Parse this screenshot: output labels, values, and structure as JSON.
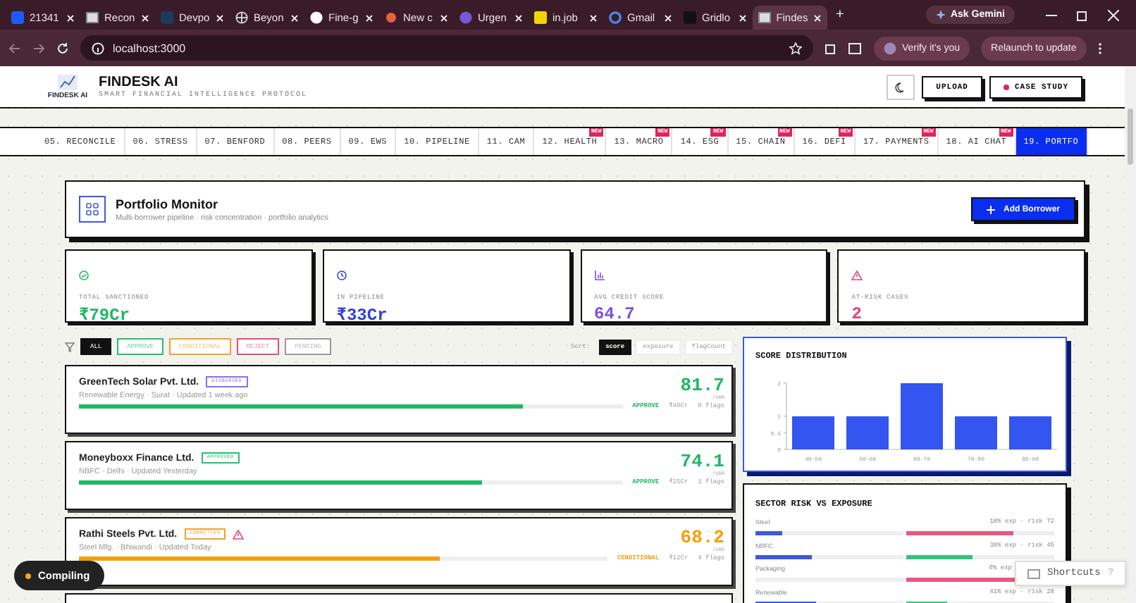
{
  "browser": {
    "tabs": [
      {
        "label": "21341",
        "selected": false
      },
      {
        "label": "Recon",
        "selected": false
      },
      {
        "label": "Devpo",
        "selected": false
      },
      {
        "label": "Beyon",
        "selected": false
      },
      {
        "label": "Fine-g",
        "selected": false
      },
      {
        "label": "New c",
        "selected": false
      },
      {
        "label": "Urgen",
        "selected": false
      },
      {
        "label": "in.job",
        "selected": false
      },
      {
        "label": "Gmail",
        "selected": false
      },
      {
        "label": "Gridlo",
        "selected": false
      },
      {
        "label": "Findes",
        "selected": true
      }
    ],
    "new_tab": "+",
    "ask": "Ask Gemini",
    "url": "localhost:3000",
    "verify": "Verify it's you",
    "relaunch": "Relaunch to update"
  },
  "header": {
    "logo_caption": "FINDESK AI",
    "title": "FINDESK AI",
    "subtitle": "SMART FINANCIAL INTELLIGENCE PROTOCOL",
    "buttons": [
      {
        "label": "UPLOAD",
        "kind": "plain"
      },
      {
        "label": "CASE STUDY",
        "kind": "dot"
      }
    ]
  },
  "nav": [
    {
      "label": "05. RECONCILE",
      "selected": false
    },
    {
      "label": "06. STRESS",
      "selected": false
    },
    {
      "label": "07. BENFORD",
      "selected": false
    },
    {
      "label": "08. PEERS",
      "selected": false
    },
    {
      "label": "09. EWS",
      "selected": false
    },
    {
      "label": "10. PIPELINE",
      "selected": false
    },
    {
      "label": "11. CAM",
      "selected": false
    },
    {
      "label": "12. HEALTH",
      "badge": "NEW",
      "selected": false
    },
    {
      "label": "13. MACRO",
      "badge": "NEW",
      "selected": false
    },
    {
      "label": "14. ESG",
      "badge": "NEW",
      "selected": false
    },
    {
      "label": "15. CHAIN",
      "badge": "NEW",
      "selected": false
    },
    {
      "label": "16. DEFI",
      "badge": "NEW",
      "selected": false
    },
    {
      "label": "17. PAYMENTS",
      "badge": "NEW",
      "selected": false
    },
    {
      "label": "18. AI CHAT",
      "badge": "NEW",
      "selected": false
    },
    {
      "label": "19. PORTFO",
      "selected": true
    }
  ],
  "portfolio": {
    "title": "Portfolio Monitor",
    "subtitle": "Multi-borrower pipeline · risk concentration · portfolio analytics",
    "button": "Add Borrower"
  },
  "stats": [
    {
      "kind": "check",
      "label": "TOTAL SANCTIONED",
      "value": "₹79Cr",
      "color": "#1fb864"
    },
    {
      "kind": "clock",
      "label": "IN PIPELINE",
      "value": "₹33Cr",
      "color": "#3340d6"
    },
    {
      "kind": "bars",
      "label": "AVG CREDIT SCORE",
      "value": "64.7",
      "color": "#7b4fe0"
    },
    {
      "kind": "alert",
      "label": "AT-RISK CASES",
      "value": "2",
      "color": "#e0457b"
    }
  ],
  "filters": [
    {
      "label": "ALL",
      "selected": true,
      "color": "#111111"
    },
    {
      "label": "APPROVE",
      "selected": false,
      "color": "#22c074"
    },
    {
      "label": "CONDITIONAL",
      "selected": false,
      "color": "#f0a030"
    },
    {
      "label": "REJECT",
      "selected": false,
      "color": "#e0507e"
    },
    {
      "label": "PENDING",
      "selected": false,
      "color": "#999999"
    }
  ],
  "sort": {
    "label": "Sort:",
    "options": [
      {
        "label": "score",
        "selected": true
      },
      {
        "label": "exposure",
        "selected": false
      },
      {
        "label": "flagCount",
        "selected": false
      }
    ]
  },
  "borrowers": [
    {
      "name": "GreenTech Solar Pvt. Ltd.",
      "status": {
        "label": "DISBURSED",
        "color": "#8b6cf0"
      },
      "warning": false,
      "meta": "Renewable Energy · Surat · Updated 1 week ago",
      "score": "81.7",
      "out_of": "/100",
      "level": 0.817,
      "color": "#1fb864",
      "decision": "APPROVE",
      "amount": "₹40Cr",
      "flags": "0 flags"
    },
    {
      "name": "Moneyboxx Finance Ltd.",
      "status": {
        "label": "APPROVED",
        "color": "#22c074"
      },
      "warning": false,
      "meta": "NBFC · Delhi · Updated Yesterday",
      "score": "74.1",
      "out_of": "/100",
      "level": 0.741,
      "color": "#1fb864",
      "decision": "APPROVE",
      "amount": "₹25Cr",
      "flags": "1 flags"
    },
    {
      "name": "Rathi Steels Pvt. Ltd.",
      "status": {
        "label": "COMMITTED",
        "color": "#f0a030"
      },
      "warning": true,
      "meta": "Steel Mfg. · Bhiwandi · Updated Today",
      "score": "68.2",
      "out_of": "/100",
      "level": 0.682,
      "color": "#f59e0b",
      "decision": "CONDITIONAL",
      "amount": "₹12Cr",
      "flags": "4 flags"
    }
  ],
  "chart_data": {
    "type": "bar",
    "title": "SCORE DISTRIBUTION",
    "categories": [
      "40-50",
      "50-60",
      "60-70",
      "70-80",
      "80-90"
    ],
    "series": [
      {
        "color": "#3355f0",
        "values": [
          1,
          1,
          2,
          1,
          1
        ]
      }
    ],
    "ylim": [
      0,
      2
    ],
    "yticks": [
      0,
      0.5,
      1,
      2
    ]
  },
  "sector": {
    "title": "SECTOR RISK VS EXPOSURE",
    "rows": [
      {
        "name": "Steel",
        "reading": "18% exp · risk 72",
        "exposure": {
          "level": 0.18
        },
        "risk": {
          "level": 0.72,
          "color": "#e8577f"
        }
      },
      {
        "name": "NBFC",
        "reading": "38% exp · risk 45",
        "exposure": {
          "level": 0.38
        },
        "risk": {
          "level": 0.45,
          "color": "#2cc77a"
        }
      },
      {
        "name": "Packaging",
        "reading": "0% exp",
        "exposure": {
          "level": 0
        },
        "risk": {
          "level": 0.75,
          "color": "#e8577f"
        }
      },
      {
        "name": "Renewable",
        "reading": "41% exp · risk 28",
        "exposure": {
          "level": 0.41
        },
        "risk": {
          "level": 0.28,
          "color": "#2cc77a"
        }
      }
    ]
  },
  "toast": {
    "label": "Compiling"
  },
  "shortcuts": {
    "label": "Shortcuts",
    "key": "?"
  }
}
